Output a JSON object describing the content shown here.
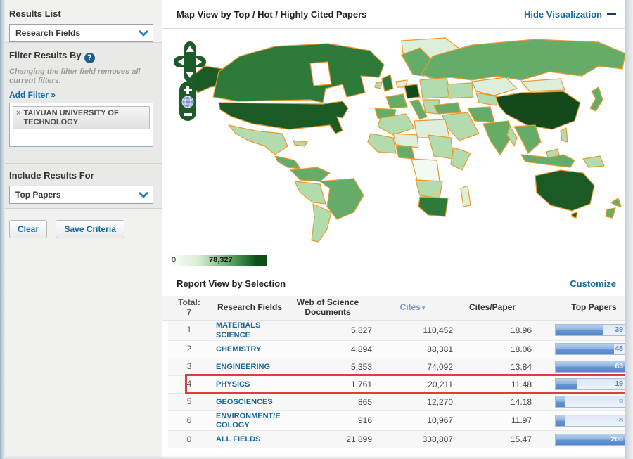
{
  "sidebar": {
    "results_list": {
      "title": "Results List",
      "selected": "Research Fields"
    },
    "filter": {
      "title": "Filter Results By",
      "help_symbol": "?",
      "note": "Changing the filter field removes all current filters.",
      "add_filter_label": "Add Filter »",
      "active_filter": {
        "remove_symbol": "×",
        "label": "TAIYUAN UNIVERSITY OF TECHNOLOGY"
      }
    },
    "include_results": {
      "title": "Include Results For",
      "selected": "Top Papers"
    },
    "actions": {
      "clear_label": "Clear",
      "save_label": "Save Criteria"
    }
  },
  "map_panel": {
    "title": "Map View by Top / Hot / Highly Cited Papers",
    "hide_visualization_label": "Hide Visualization",
    "legend": {
      "min": "0",
      "max": "78,327"
    },
    "colors": {
      "country_border": "#e9992f",
      "choropleth_scale": [
        "#f3faf2",
        "#ddefdb",
        "#b2dcae",
        "#64ac68",
        "#2e7a3a",
        "#1a5a24",
        "#124a1c"
      ],
      "link_blue": "#176a9e",
      "control_green": "#1d5c28"
    }
  },
  "report": {
    "title": "Report View by Selection",
    "customize_label": "Customize",
    "total_label": "Total:",
    "total_value": "7",
    "columns": {
      "research_fields": "Research Fields",
      "documents": "Web of Science Documents",
      "cites": "Cites",
      "cites_per_paper": "Cites/Paper",
      "top_papers": "Top Papers"
    },
    "sort": {
      "column": "Cites",
      "indicator": "▾"
    },
    "rows": [
      {
        "rank": "1",
        "field": "MATERIALS SCIENCE",
        "documents": "5,827",
        "cites": "110,452",
        "cites_per_paper": "18.96",
        "top_papers": "39",
        "bar_pct": 62,
        "highlighted": false
      },
      {
        "rank": "2",
        "field": "CHEMISTRY",
        "documents": "4,894",
        "cites": "88,381",
        "cites_per_paper": "18.06",
        "top_papers": "48",
        "bar_pct": 76,
        "highlighted": false
      },
      {
        "rank": "3",
        "field": "ENGINEERING",
        "documents": "5,353",
        "cites": "74,092",
        "cites_per_paper": "13.84",
        "top_papers": "63",
        "bar_pct": 100,
        "highlighted": false
      },
      {
        "rank": "4",
        "field": "PHYSICS",
        "documents": "1,761",
        "cites": "20,211",
        "cites_per_paper": "11.48",
        "top_papers": "19",
        "bar_pct": 28,
        "highlighted": true
      },
      {
        "rank": "5",
        "field": "GEOSCIENCES",
        "documents": "865",
        "cites": "12,270",
        "cites_per_paper": "14.18",
        "top_papers": "9",
        "bar_pct": 13,
        "highlighted": false
      },
      {
        "rank": "6",
        "field": "ENVIRONMENT/ECOLOGY",
        "documents": "916",
        "cites": "10,967",
        "cites_per_paper": "11.97",
        "top_papers": "8",
        "bar_pct": 12,
        "highlighted": false
      },
      {
        "rank": "0",
        "field": "ALL FIELDS",
        "documents": "21,899",
        "cites": "338,807",
        "cites_per_paper": "15.47",
        "top_papers": "206",
        "bar_pct": 100,
        "highlighted": false
      }
    ]
  }
}
